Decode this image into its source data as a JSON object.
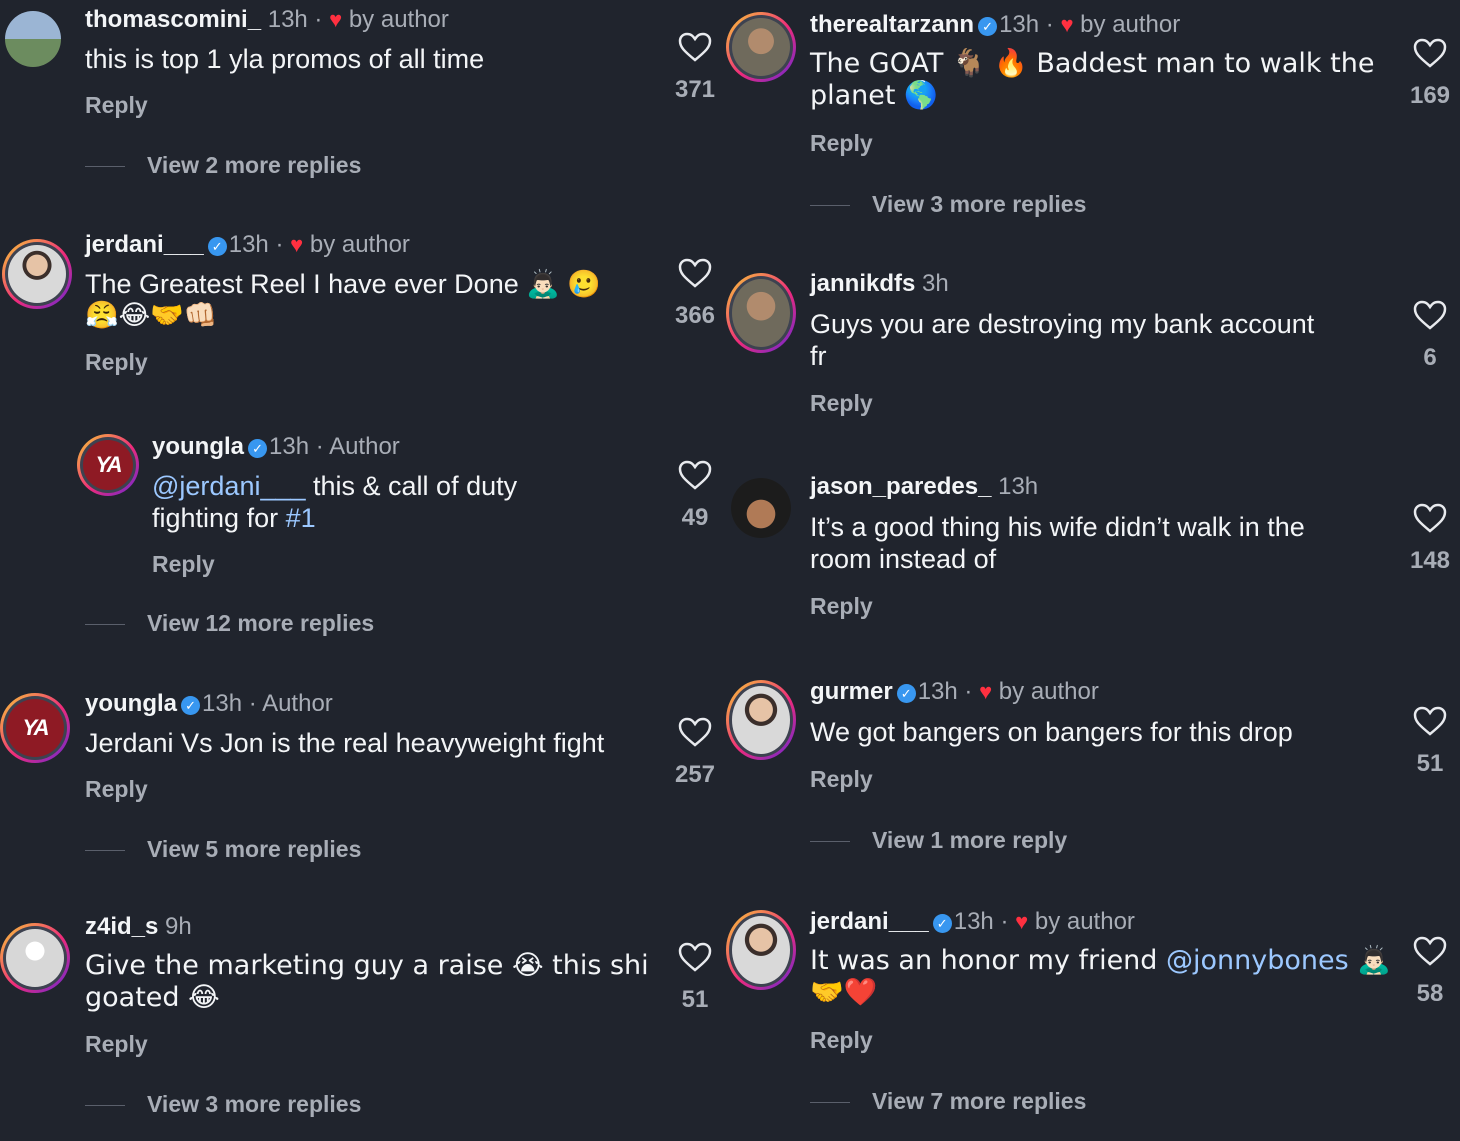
{
  "left": [
    {
      "user": "thomascomini_",
      "verified": false,
      "time": "13h",
      "badge": "by author",
      "badge_heart": true,
      "text": "this is top 1 yla promos of all time",
      "reply": "Reply",
      "likes": "371",
      "view_more": "View 2 more replies"
    },
    {
      "user": "jerdani___",
      "verified": true,
      "time": "13h",
      "badge": "by author",
      "badge_heart": true,
      "text": "The Greatest Reel I have ever Done 🙇🏻‍♂️ 🥲",
      "text2": "😤😂🤝👊🏻",
      "reply": "Reply",
      "likes": "366"
    },
    {
      "user": "youngla",
      "verified": true,
      "time": "13h",
      "badge": "Author",
      "badge_heart": false,
      "mention": "@jerdani___",
      "text": " this & call of duty",
      "text2a": "fighting for ",
      "hashtag": "#1",
      "reply": "Reply",
      "likes": "49",
      "view_more": "View 12 more replies"
    },
    {
      "user": "youngla",
      "verified": true,
      "time": "13h",
      "badge": "Author",
      "badge_heart": false,
      "text": "Jerdani Vs Jon is the real heavyweight fight",
      "reply": "Reply",
      "likes": "257",
      "view_more": "View 5 more replies"
    },
    {
      "user": "z4id_s",
      "verified": false,
      "time": "9h",
      "text": "Give the marketing guy a raise 😭 this shi",
      "text2": "goated 😂",
      "reply": "Reply",
      "likes": "51",
      "view_more": "View 3 more replies"
    }
  ],
  "right": [
    {
      "user": "therealtarzann",
      "verified": true,
      "time": "13h",
      "badge": "by author",
      "badge_heart": true,
      "text": "The GOAT 🐐 🔥 Baddest man to walk the",
      "text2": "planet 🌎",
      "reply": "Reply",
      "likes": "169",
      "view_more": "View 3 more replies"
    },
    {
      "user": "jannikdfs",
      "verified": false,
      "time": "3h",
      "text": "Guys you are destroying my bank account",
      "text2": "fr",
      "reply": "Reply",
      "likes": "6"
    },
    {
      "user": "jason_paredes_",
      "verified": false,
      "time": "13h",
      "text": "It’s a good thing his wife didn’t walk in the",
      "text2": "room instead of",
      "reply": "Reply",
      "likes": "148"
    },
    {
      "user": "gurmer",
      "verified": true,
      "time": "13h",
      "badge": "by author",
      "badge_heart": true,
      "text": "We got bangers on bangers for this drop",
      "reply": "Reply",
      "likes": "51",
      "view_more": "View 1 more reply"
    },
    {
      "user": "jerdani___",
      "verified": true,
      "time": "13h",
      "badge": "by author",
      "badge_heart": true,
      "text": "It was an honor my friend ",
      "mention": "@jonnybones",
      "text_after": " 🙇🏻‍♂️",
      "text2": "🤝❤️",
      "reply": "Reply",
      "likes": "58",
      "view_more": "View 7 more replies"
    }
  ],
  "icons": {
    "like": "heart-outline-icon",
    "badge": "heart-filled-icon",
    "verified": "verified-badge-icon"
  },
  "colors": {
    "background": "#20242d",
    "text": "#f3f5f7",
    "muted": "#a8adb6",
    "verified": "#3897f0",
    "liked": "#ff3040",
    "link": "#9cc8ff"
  }
}
